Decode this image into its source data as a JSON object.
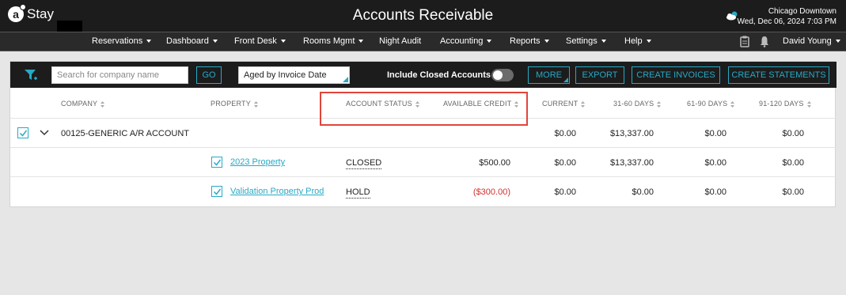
{
  "header": {
    "logo_letter": "a",
    "logo_text": "Stay",
    "title": "Accounts Receivable",
    "weather_icon": "cloud-sun-icon",
    "location": "Chicago Downtown",
    "datetime": "Wed, Dec 06, 2024 7:03 PM"
  },
  "nav": {
    "items": [
      {
        "label": "Reservations",
        "dropdown": true
      },
      {
        "label": "Dashboard",
        "dropdown": true
      },
      {
        "label": "Front Desk",
        "dropdown": true
      },
      {
        "label": "Rooms Mgmt",
        "dropdown": true
      },
      {
        "label": "Night Audit",
        "dropdown": false
      },
      {
        "label": "Accounting",
        "dropdown": true
      },
      {
        "label": "Reports",
        "dropdown": true
      },
      {
        "label": "Settings",
        "dropdown": true
      },
      {
        "label": "Help",
        "dropdown": true
      }
    ],
    "clipboard_icon": "clipboard-icon",
    "bell_icon": "bell-icon",
    "user": "David Young"
  },
  "toolbar": {
    "filter_icon": "filter-plus-icon",
    "search_placeholder": "Search for company name",
    "go_label": "GO",
    "aged_by": "Aged by Invoice Date",
    "include_closed_label": "Include Closed Accounts",
    "include_closed_on": false,
    "more_label": "MORE",
    "export_label": "EXPORT",
    "create_invoices_label": "CREATE INVOICES",
    "create_statements_label": "CREATE STATEMENTS"
  },
  "table": {
    "columns": {
      "company": "COMPANY",
      "property": "PROPERTY",
      "account_status": "ACCOUNT STATUS",
      "available_credit": "AVAILABLE CREDIT",
      "current": "CURRENT",
      "d31_60": "31-60 DAYS",
      "d61_90": "61-90 DAYS",
      "d91_120": "91-120 DAYS"
    },
    "group": {
      "checked": true,
      "expanded": true,
      "company": "00125-GENERIC A/R ACCOUNT",
      "current": "$0.00",
      "d31_60": "$13,337.00",
      "d61_90": "$0.00",
      "d91_120": "$0.00"
    },
    "rows": [
      {
        "checked": true,
        "property": "2023 Property",
        "status": "CLOSED",
        "available_credit": "$500.00",
        "current": "$0.00",
        "d31_60": "$13,337.00",
        "d61_90": "$0.00",
        "d91_120": "$0.00"
      },
      {
        "checked": true,
        "property": "Validation Property Prod",
        "status": "HOLD",
        "available_credit": "($300.00)",
        "current": "$0.00",
        "d31_60": "$0.00",
        "d61_90": "$0.00",
        "d91_120": "$0.00"
      }
    ]
  },
  "colors": {
    "accent": "#28a9c6",
    "header_bg": "#1c1c1c",
    "negative": "#d0312d",
    "highlight": "#e0453a"
  }
}
